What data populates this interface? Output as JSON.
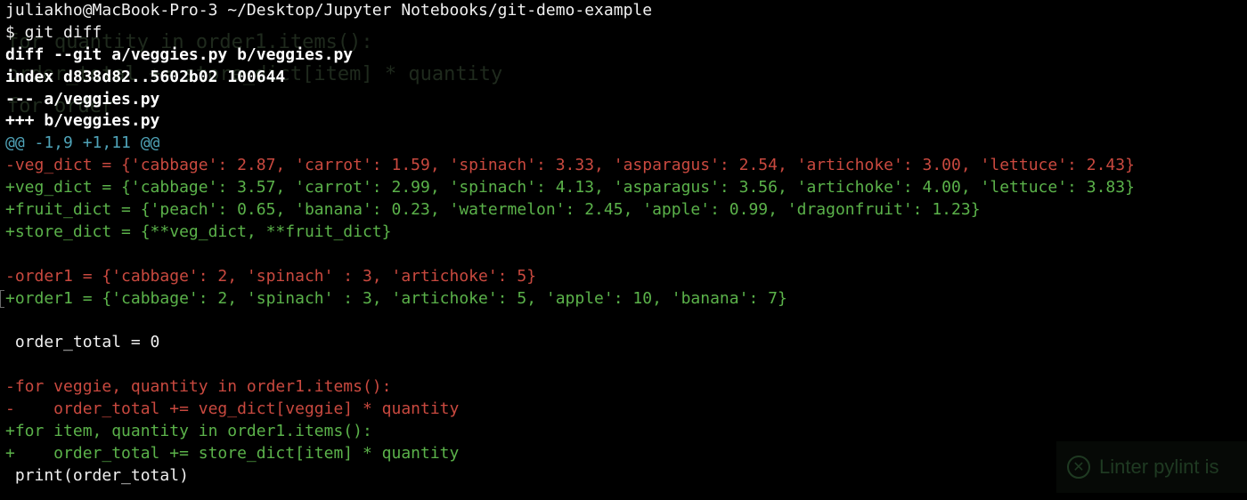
{
  "background_ghost": {
    "line1": "for quantity in order1.items():",
    "line2": "order_total += store_dict[item] * quantity",
    "line3": "for order"
  },
  "terminal": {
    "prompt_header": "juliakho@MacBook-Pro-3 ~/Desktop/Jupyter Notebooks/git-demo-example",
    "command": "$ git diff",
    "diff_header": "diff --git a/veggies.py b/veggies.py",
    "index_line": "index d838d82..5602b02 100644",
    "old_file": "--- a/veggies.py",
    "new_file": "+++ b/veggies.py",
    "hunk_header": "@@ -1,9 +1,11 @@",
    "lines": [
      {
        "kind": "del",
        "text": "-veg_dict = {'cabbage': 2.87, 'carrot': 1.59, 'spinach': 3.33, 'asparagus': 2.54, 'artichoke': 3.00, 'lettuce': 2.43}"
      },
      {
        "kind": "add",
        "text": "+veg_dict = {'cabbage': 3.57, 'carrot': 2.99, 'spinach': 4.13, 'asparagus': 3.56, 'artichoke': 4.00, 'lettuce': 3.83}"
      },
      {
        "kind": "add",
        "text": "+fruit_dict = {'peach': 0.65, 'banana': 0.23, 'watermelon': 2.45, 'apple': 0.99, 'dragonfruit': 1.23}"
      },
      {
        "kind": "add",
        "text": "+store_dict = {**veg_dict, **fruit_dict}"
      },
      {
        "kind": "ctx",
        "text": ""
      },
      {
        "kind": "del",
        "text": "-order1 = {'cabbage': 2, 'spinach' : 3, 'artichoke': 5}"
      },
      {
        "kind": "add",
        "text": "+order1 = {'cabbage': 2, 'spinach' : 3, 'artichoke': 5, 'apple': 10, 'banana': 7}"
      },
      {
        "kind": "ctx",
        "text": ""
      },
      {
        "kind": "ctx",
        "text": " order_total = 0"
      },
      {
        "kind": "ctx",
        "text": ""
      },
      {
        "kind": "del",
        "text": "-for veggie, quantity in order1.items():"
      },
      {
        "kind": "del",
        "text": "-    order_total += veg_dict[veggie] * quantity"
      },
      {
        "kind": "add",
        "text": "+for item, quantity in order1.items():"
      },
      {
        "kind": "add",
        "text": "+    order_total += store_dict[item] * quantity"
      },
      {
        "kind": "ctx",
        "text": " print(order_total)"
      }
    ]
  },
  "toast": {
    "icon": "close-circle-icon",
    "text": "Linter pylint is"
  },
  "colors": {
    "background": "#000000",
    "deleted": "#c9493f",
    "added": "#5bb24a",
    "hunk": "#4fa3b8",
    "text": "#f0f0f0"
  }
}
